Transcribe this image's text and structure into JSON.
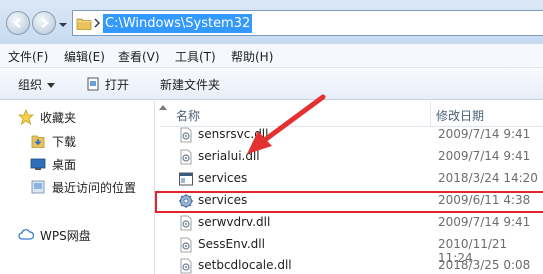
{
  "address_bar": {
    "path": "C:\\Windows\\System32"
  },
  "menubar": {
    "items": [
      "文件(F)",
      "编辑(E)",
      "查看(V)",
      "工具(T)",
      "帮助(H)"
    ]
  },
  "toolbar": {
    "organize_label": "组织",
    "open_label": "打开",
    "new_folder_label": "新建文件夹"
  },
  "nav_pane": {
    "favorites": "收藏夹",
    "downloads": "下载",
    "desktop": "桌面",
    "recent": "最近访问的位置",
    "wps": "WPS网盘"
  },
  "file_list": {
    "col_name": "名称",
    "col_date": "修改日期",
    "rows": [
      {
        "name": "sensrsvc.dll",
        "date": "2009/7/14 9:41",
        "icon": "dll-file-icon"
      },
      {
        "name": "serialui.dll",
        "date": "2009/7/14 9:41",
        "icon": "dll-file-icon"
      },
      {
        "name": "services",
        "date": "2018/3/24 14:20",
        "icon": "msc-file-icon"
      },
      {
        "name": "services",
        "date": "2009/6/11 4:38",
        "icon": "exe-gear-icon"
      },
      {
        "name": "serwvdrv.dll",
        "date": "2009/7/14 9:41",
        "icon": "dll-file-icon"
      },
      {
        "name": "SessEnv.dll",
        "date": "2010/11/21 11:24",
        "icon": "dll-file-icon"
      },
      {
        "name": "setbcdlocale.dll",
        "date": "2018/3/25 0:08",
        "icon": "dll-file-icon"
      }
    ]
  },
  "colors": {
    "highlight_border": "#e0262b",
    "selection": "#3399ff"
  }
}
